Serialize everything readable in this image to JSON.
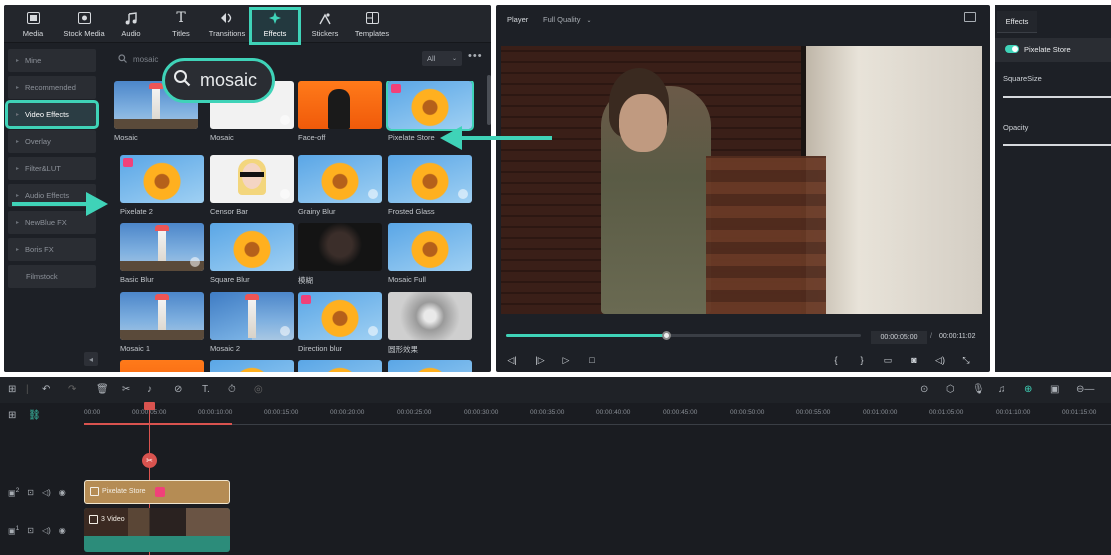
{
  "top_tabs": [
    {
      "label": "Media",
      "icon": "media-icon"
    },
    {
      "label": "Stock Media",
      "icon": "stock-media-icon"
    },
    {
      "label": "Audio",
      "icon": "music-note-icon"
    },
    {
      "label": "Titles",
      "icon": "text-t-icon"
    },
    {
      "label": "Transitions",
      "icon": "transition-icon"
    },
    {
      "label": "Effects",
      "icon": "effects-star-icon"
    },
    {
      "label": "Stickers",
      "icon": "sticker-icon"
    },
    {
      "label": "Templates",
      "icon": "template-icon"
    }
  ],
  "categories": [
    {
      "label": "Mine"
    },
    {
      "label": "Recommended"
    },
    {
      "label": "Video Effects"
    },
    {
      "label": "Overlay"
    },
    {
      "label": "Filter&LUT"
    },
    {
      "label": "Audio Effects"
    },
    {
      "label": "NewBlue FX"
    },
    {
      "label": "Boris FX"
    },
    {
      "label": "Filmstock"
    }
  ],
  "search": {
    "value": "mosaic",
    "filter": "All",
    "more": "•••"
  },
  "callout": {
    "text": "mosaic"
  },
  "effects": [
    {
      "name": "Mosaic",
      "thumb": "lighthouse"
    },
    {
      "name": "Mosaic",
      "thumb": "white-person"
    },
    {
      "name": "Face-off",
      "thumb": "orange-person"
    },
    {
      "name": "Pixelate Store",
      "thumb": "flower",
      "selected": true,
      "premium": true
    },
    {
      "name": "Pixelate 2",
      "thumb": "flower",
      "premium": true
    },
    {
      "name": "Censor Bar",
      "thumb": "censor-bar"
    },
    {
      "name": "Grainy Blur",
      "thumb": "flower"
    },
    {
      "name": "Frosted Glass",
      "thumb": "flower"
    },
    {
      "name": "Basic Blur",
      "thumb": "lighthouse"
    },
    {
      "name": "Square Blur",
      "thumb": "flower"
    },
    {
      "name": "模糊",
      "thumb": "dark-person"
    },
    {
      "name": "Mosaic Full",
      "thumb": "flower"
    },
    {
      "name": "Mosaic 1",
      "thumb": "lighthouse"
    },
    {
      "name": "Mosaic 2",
      "thumb": "lighthouse-split"
    },
    {
      "name": "Direction blur",
      "thumb": "flower",
      "premium": true
    },
    {
      "name": "圆形效果",
      "thumb": "grey-circle"
    }
  ],
  "player": {
    "label": "Player",
    "quality": "Full Quality",
    "current_time": "00:00:05:00",
    "separator": "/",
    "total_time": "00:00:11:02",
    "progress_fraction": 0.45
  },
  "props": {
    "tab": "Effects",
    "effect_name": "Pixelate Store",
    "enabled": true,
    "square_size_label": "SquareSize",
    "opacity_label": "Opacity"
  },
  "timeline": {
    "ruler_labels": [
      "00:00",
      "00:00:05:00",
      "00:00:10:00",
      "00:00:15:00",
      "00:00:20:00",
      "00:00:25:00",
      "00:00:30:00",
      "00:00:35:00",
      "00:00:40:00",
      "00:00:45:00",
      "00:00:50:00",
      "00:00:55:00",
      "00:01:00:00",
      "00:01:05:00",
      "00:01:10:00",
      "00:01:15:00"
    ],
    "tracks": [
      {
        "number": "2",
        "clip_label": "Pixelate Store"
      },
      {
        "number": "1",
        "clip_label": "3 Video"
      }
    ]
  },
  "colors": {
    "accent": "#3fd3b8",
    "playhead": "#d9534f",
    "premium": "#f0417a",
    "effect_clip": "#b58c54",
    "video_clip": "#2c8c7a"
  }
}
